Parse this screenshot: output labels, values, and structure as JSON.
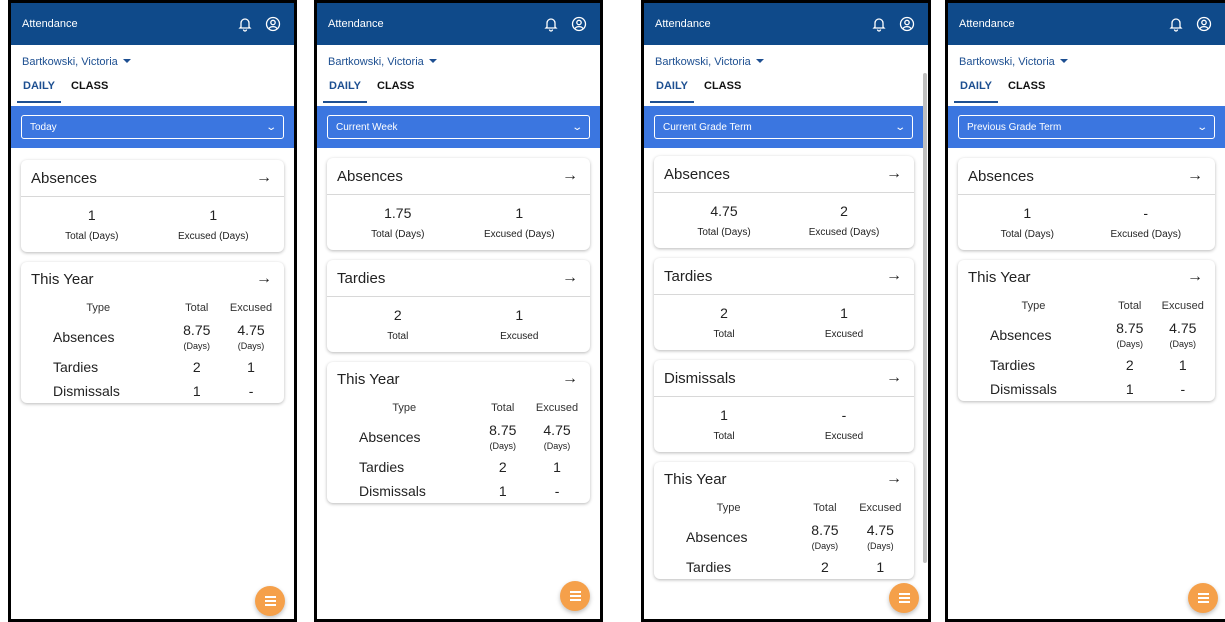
{
  "app": {
    "title": "Attendance",
    "student": "Bartkowski, Victoria"
  },
  "tabs": [
    "DAILY",
    "CLASS"
  ],
  "icons": {
    "bell": "bell-icon",
    "account": "account-icon",
    "menu": "menu-icon"
  },
  "colors": {
    "appbar": "#0f4a8a",
    "filterbar": "#3b76e0",
    "fab": "#f5a04a",
    "link": "#1d4f91"
  },
  "year_table_headers": {
    "type": "Type",
    "total": "Total",
    "excused": "Excused"
  },
  "screens": [
    {
      "filter": "Today",
      "absences": {
        "title": "Absences",
        "total": "1",
        "excused": "1",
        "total_label": "Total (Days)",
        "excused_label": "Excused (Days)"
      },
      "this_year": {
        "title": "This Year",
        "absences": {
          "label": "Absences",
          "total": "8.75",
          "total_unit": "(Days)",
          "excused": "4.75",
          "excused_unit": "(Days)"
        },
        "tardies": {
          "label": "Tardies",
          "total": "2",
          "excused": "1"
        },
        "dismissals": {
          "label": "Dismissals",
          "total": "1",
          "excused": "-"
        }
      }
    },
    {
      "filter": "Current Week",
      "absences": {
        "title": "Absences",
        "total": "1.75",
        "excused": "1",
        "total_label": "Total (Days)",
        "excused_label": "Excused (Days)"
      },
      "tardies": {
        "title": "Tardies",
        "total": "2",
        "excused": "1",
        "total_label": "Total",
        "excused_label": "Excused"
      },
      "this_year": {
        "title": "This Year",
        "absences": {
          "label": "Absences",
          "total": "8.75",
          "total_unit": "(Days)",
          "excused": "4.75",
          "excused_unit": "(Days)"
        },
        "tardies": {
          "label": "Tardies",
          "total": "2",
          "excused": "1"
        },
        "dismissals": {
          "label": "Dismissals",
          "total": "1",
          "excused": "-"
        }
      }
    },
    {
      "filter": "Current Grade Term",
      "absences": {
        "title": "Absences",
        "total": "4.75",
        "excused": "2",
        "total_label": "Total (Days)",
        "excused_label": "Excused (Days)"
      },
      "tardies": {
        "title": "Tardies",
        "total": "2",
        "excused": "1",
        "total_label": "Total",
        "excused_label": "Excused"
      },
      "dismissals": {
        "title": "Dismissals",
        "total": "1",
        "excused": "-",
        "total_label": "Total",
        "excused_label": "Excused"
      },
      "this_year": {
        "title": "This Year",
        "absences": {
          "label": "Absences",
          "total": "8.75",
          "total_unit": "(Days)",
          "excused": "4.75",
          "excused_unit": "(Days)"
        },
        "tardies": {
          "label": "Tardies",
          "total": "2",
          "excused": "1"
        }
      }
    },
    {
      "filter": "Previous Grade Term",
      "absences": {
        "title": "Absences",
        "total": "1",
        "excused": "-",
        "total_label": "Total (Days)",
        "excused_label": "Excused (Days)"
      },
      "this_year": {
        "title": "This Year",
        "absences": {
          "label": "Absences",
          "total": "8.75",
          "total_unit": "(Days)",
          "excused": "4.75",
          "excused_unit": "(Days)"
        },
        "tardies": {
          "label": "Tardies",
          "total": "2",
          "excused": "1"
        },
        "dismissals": {
          "label": "Dismissals",
          "total": "1",
          "excused": "-"
        }
      }
    }
  ]
}
